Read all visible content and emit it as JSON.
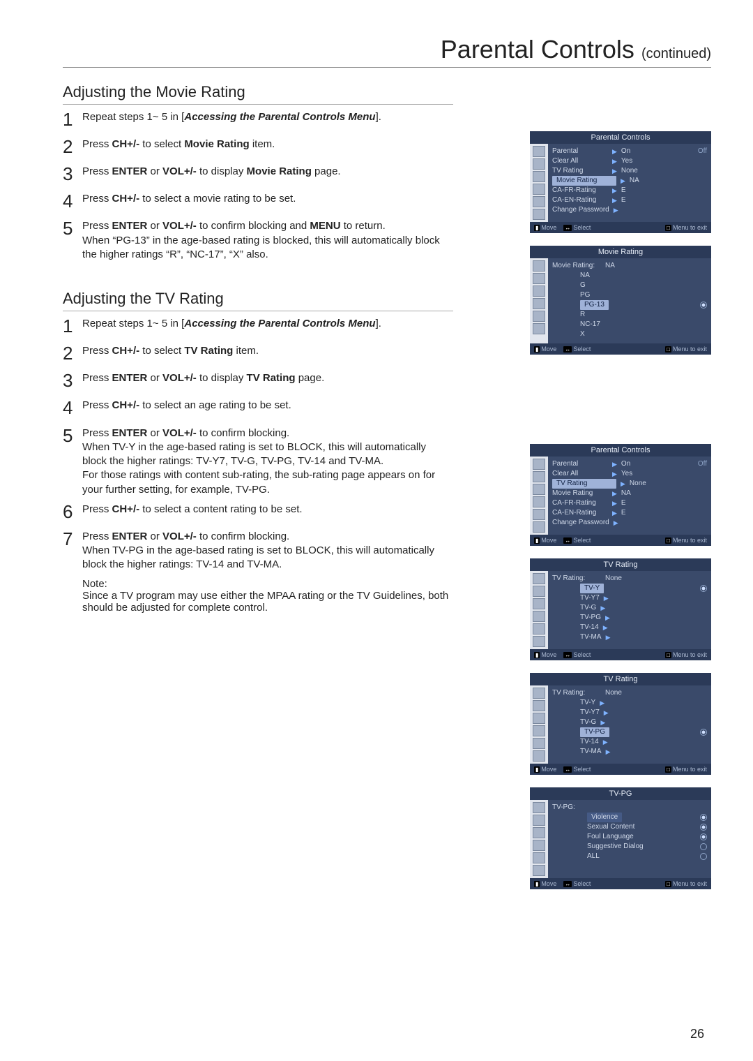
{
  "pageNumber": "26",
  "pageTitle": "Parental Controls",
  "pageTitleSuffix": "(continued)",
  "movie": {
    "heading": "Adjusting the Movie Rating",
    "steps": [
      "Repeat steps 1~ 5 in [<i class='bi'>Accessing the Parental Controls Menu</i>].",
      "Press <b>CH+/-</b> to select <b>Movie Rating</b> item.",
      "Press <b>ENTER</b> or <b>VOL+/-</b> to display <b>Movie Rating</b> page.",
      "Press <b>CH+/-</b> to select a movie rating to be set.",
      "Press <b>ENTER</b> or <b>VOL+/-</b> to confirm blocking and <b>MENU</b> to return.<br>When “PG-13” in the age-based rating is blocked, this will automatically block the higher ratings “R”, “NC-17”, “X” also."
    ]
  },
  "tv": {
    "heading": "Adjusting the TV Rating",
    "steps": [
      "Repeat steps 1~ 5 in [<i class='bi'>Accessing the Parental Controls Menu</i>].",
      "Press <b>CH+/-</b> to select <b>TV Rating</b> item.",
      "Press <b>ENTER</b> or <b>VOL+/-</b> to display <b>TV Rating</b> page.",
      "Press <b>CH+/-</b> to select an age rating to be set.",
      "Press <b>ENTER</b> or <b>VOL+/-</b> to confirm blocking.<br>When TV-Y in the age-based rating is set to BLOCK, this will automatically block the higher ratings: TV-Y7, TV-G, TV-PG, TV-14 and TV-MA.<br>For those ratings with content sub-rating, the sub-rating page appears on for your further setting, for example, TV-PG.",
      "Press <b>CH+/-</b> to select a content rating to be set.",
      "Press <b>ENTER</b> or <b>VOL+/-</b> to confirm blocking.<br>When TV-PG in the age-based rating is set to BLOCK, this will automatically block the higher ratings: TV-14 and TV-MA."
    ],
    "noteLabel": "Note:",
    "noteText": "Since a TV program may use either the MPAA rating or the TV Guidelines, both should be adjusted for complete control."
  },
  "osd": {
    "footer": {
      "move": "Move",
      "select": "Select",
      "menu": "Menu to exit",
      "moveKey": "▮",
      "selKey": "↔",
      "menuKey": "□"
    },
    "parentalControls": {
      "title": "Parental Controls",
      "items": [
        {
          "label": "Parental",
          "value": "On",
          "extra": "Off"
        },
        {
          "label": "Clear All",
          "value": "Yes"
        },
        {
          "label": "TV Rating",
          "value": "None"
        },
        {
          "label": "Movie Rating",
          "value": "NA",
          "selected": true
        },
        {
          "label": "CA-FR-Rating",
          "value": "E"
        },
        {
          "label": "CA-EN-Rating",
          "value": "E"
        },
        {
          "label": "Change Password",
          "value": ""
        }
      ]
    },
    "movieRating": {
      "title": "Movie Rating",
      "caption": "Movie Rating:",
      "captionValue": "NA",
      "options": [
        "NA",
        "G",
        "PG",
        "PG-13",
        "R",
        "NC-17",
        "X"
      ],
      "selected": "PG-13"
    },
    "parentalControlsTV": {
      "title": "Parental Controls",
      "items": [
        {
          "label": "Parental",
          "value": "On",
          "extra": "Off"
        },
        {
          "label": "Clear All",
          "value": "Yes"
        },
        {
          "label": "TV Rating",
          "value": "None",
          "selected": true
        },
        {
          "label": "Movie Rating",
          "value": "NA"
        },
        {
          "label": "CA-FR-Rating",
          "value": "E"
        },
        {
          "label": "CA-EN-Rating",
          "value": "E"
        },
        {
          "label": "Change Password",
          "value": ""
        }
      ]
    },
    "tvRating1": {
      "title": "TV Rating",
      "caption": "TV Rating:",
      "captionValue": "None",
      "options": [
        "TV-Y",
        "TV-Y7",
        "TV-G",
        "TV-PG",
        "TV-14",
        "TV-MA"
      ],
      "selected": "TV-Y"
    },
    "tvRating2": {
      "title": "TV Rating",
      "caption": "TV Rating:",
      "captionValue": "None",
      "options": [
        "TV-Y",
        "TV-Y7",
        "TV-G",
        "TV-PG",
        "TV-14",
        "TV-MA"
      ],
      "selected": "TV-PG"
    },
    "tvpg": {
      "title": "TV-PG",
      "caption": "TV-PG:",
      "items": [
        {
          "label": "Violence",
          "on": true
        },
        {
          "label": "Sexual Content",
          "on": true
        },
        {
          "label": "Foul Language",
          "on": true
        },
        {
          "label": "Suggestive Dialog",
          "on": false
        },
        {
          "label": "ALL",
          "on": false
        }
      ]
    }
  }
}
